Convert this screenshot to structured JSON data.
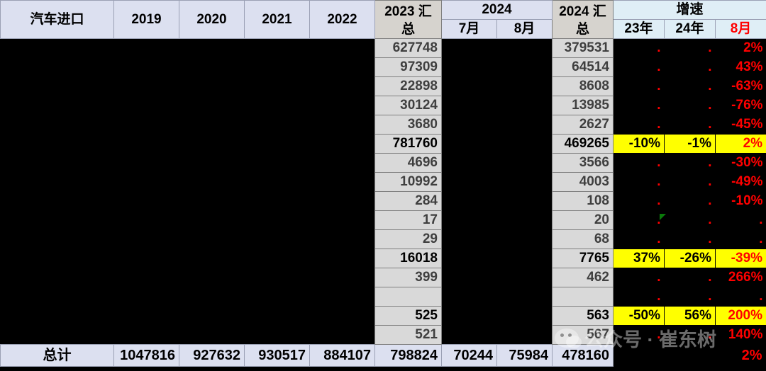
{
  "sheet": {
    "title": "汽车进口",
    "columns": {
      "row_label": "汽车进口",
      "y2019": "2019",
      "y2020": "2020",
      "y2021": "2021",
      "y2022": "2022",
      "y2023_total_l1": "2023 汇",
      "y2023_total_l2": "总",
      "y2024_group": "2024",
      "y2024_m7": "7月",
      "y2024_m8": "8月",
      "y2024_total_l1": "2024 汇",
      "y2024_total_l2": "总",
      "growth_group": "增速",
      "growth_23": "23年",
      "growth_24": "24年",
      "growth_m8": "8月"
    },
    "rows": [
      {
        "y2023": "627748",
        "m7": "",
        "m8": "",
        "y2024": "379531",
        "g23": "",
        "g24": "",
        "g8": "2%",
        "bold": false,
        "hl": false
      },
      {
        "y2023": "97309",
        "m7": "",
        "m8": "",
        "y2024": "64514",
        "g23": "",
        "g24": "",
        "g8": "43%",
        "bold": false,
        "hl": false
      },
      {
        "y2023": "22898",
        "m7": "",
        "m8": "",
        "y2024": "8608",
        "g23": "",
        "g24": "",
        "g8": "-63%",
        "bold": false,
        "hl": false
      },
      {
        "y2023": "30124",
        "m7": "",
        "m8": "",
        "y2024": "13985",
        "g23": "",
        "g24": "",
        "g8": "-76%",
        "bold": false,
        "hl": false
      },
      {
        "y2023": "3680",
        "m7": "",
        "m8": "",
        "y2024": "2627",
        "g23": "",
        "g24": "",
        "g8": "-45%",
        "bold": false,
        "hl": false
      },
      {
        "y2023": "781760",
        "m7": "",
        "m8": "",
        "y2024": "469265",
        "g23": "-10%",
        "g24": "-1%",
        "g8": "2%",
        "bold": true,
        "hl": true
      },
      {
        "y2023": "4696",
        "m7": "",
        "m8": "",
        "y2024": "3566",
        "g23": "",
        "g24": "",
        "g8": "-30%",
        "bold": false,
        "hl": false
      },
      {
        "y2023": "10992",
        "m7": "",
        "m8": "",
        "y2024": "4003",
        "g23": "",
        "g24": "",
        "g8": "-49%",
        "bold": false,
        "hl": false
      },
      {
        "y2023": "284",
        "m7": "",
        "m8": "",
        "y2024": "108",
        "g23": "",
        "g24": "",
        "g8": "-10%",
        "bold": false,
        "hl": false
      },
      {
        "y2023": "17",
        "m7": "",
        "m8": "",
        "y2024": "20",
        "g23": "",
        "g24": "",
        "g8": "",
        "bold": false,
        "hl": false
      },
      {
        "y2023": "29",
        "m7": "",
        "m8": "",
        "y2024": "68",
        "g23": "",
        "g24": "",
        "g8": "",
        "bold": false,
        "hl": false
      },
      {
        "y2023": "16018",
        "m7": "",
        "m8": "",
        "y2024": "7765",
        "g23": "37%",
        "g24": "-26%",
        "g8": "-39%",
        "bold": true,
        "hl": true
      },
      {
        "y2023": "399",
        "m7": "",
        "m8": "",
        "y2024": "462",
        "g23": "",
        "g24": "",
        "g8": "266%",
        "bold": false,
        "hl": false
      },
      {
        "y2023": "",
        "m7": "",
        "m8": "",
        "y2024": "",
        "g23": "",
        "g24": "",
        "g8": "",
        "bold": false,
        "hl": false
      },
      {
        "y2023": "525",
        "m7": "",
        "m8": "",
        "y2024": "563",
        "g23": "-50%",
        "g24": "56%",
        "g8": "200%",
        "bold": true,
        "hl": true
      },
      {
        "y2023": "521",
        "m7": "",
        "m8": "",
        "y2024": "567",
        "g23": "",
        "g24": "",
        "g8": "140%",
        "bold": false,
        "hl": false
      }
    ],
    "total": {
      "label": "总计",
      "y2019": "1047816",
      "y2020": "927632",
      "y2021": "930517",
      "y2022": "884107",
      "y2023": "798824",
      "m7": "70244",
      "m8": "75984",
      "y2024": "478160",
      "g23": "",
      "g24": "",
      "g8": "2%"
    },
    "watermark": "公众号 · 崔东树",
    "colors": {
      "header_blue": "#dce0f0",
      "header_grey": "#d6d3ce",
      "header_lightblue": "#dfeef6",
      "cell_grey": "#d9d9d9",
      "highlight_yellow": "#ffff00",
      "negative_red": "#ff0000",
      "marker_green": "#0a7a0a",
      "background_black": "#000000"
    }
  }
}
